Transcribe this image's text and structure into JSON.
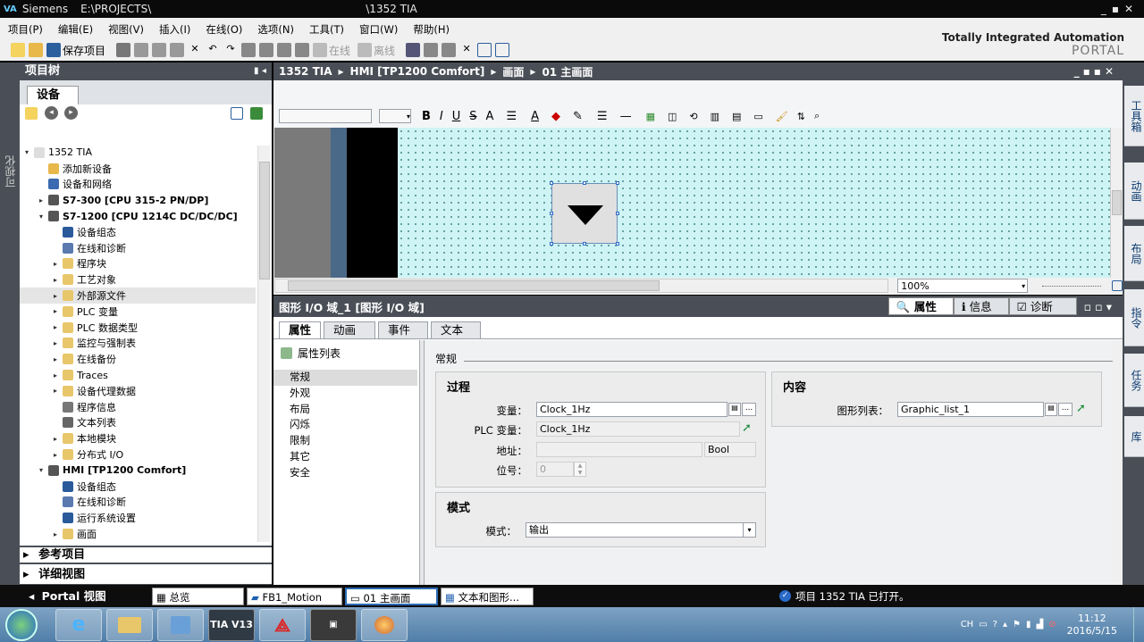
{
  "window": {
    "app": "Siemens",
    "path": "E:\\PROJECTS\\",
    "path_end": "\\1352 TIA"
  },
  "menu": [
    "项目(P)",
    "编辑(E)",
    "视图(V)",
    "插入(I)",
    "在线(O)",
    "选项(N)",
    "工具(T)",
    "窗口(W)",
    "帮助(H)"
  ],
  "toolbar": {
    "save_label": "保存项目",
    "online_label": "在线",
    "offline_label": "离线"
  },
  "brand": {
    "line1": "Totally Integrated Automation",
    "line2": "PORTAL"
  },
  "left_vtab": "可视化",
  "project_tree": {
    "title": "项目树",
    "tab": "设备",
    "items": [
      {
        "label": "1352 TIA",
        "indent": 0,
        "arrow": "▾",
        "icon": "project-icon",
        "bold": false
      },
      {
        "label": "添加新设备",
        "indent": 1,
        "arrow": "",
        "icon": "add-device-icon",
        "bold": false
      },
      {
        "label": "设备和网络",
        "indent": 1,
        "arrow": "",
        "icon": "network-icon",
        "bold": false
      },
      {
        "label": "S7-300 [CPU 315-2 PN/DP]",
        "indent": 1,
        "arrow": "▸",
        "icon": "plc-icon",
        "bold": true
      },
      {
        "label": "S7-1200 [CPU 1214C DC/DC/DC]",
        "indent": 1,
        "arrow": "▾",
        "icon": "plc-icon",
        "bold": true
      },
      {
        "label": "设备组态",
        "indent": 2,
        "arrow": "",
        "icon": "device-config-icon",
        "bold": false
      },
      {
        "label": "在线和诊断",
        "indent": 2,
        "arrow": "",
        "icon": "diagnostics-icon",
        "bold": false
      },
      {
        "label": "程序块",
        "indent": 2,
        "arrow": "▸",
        "icon": "folder-icon",
        "bold": false
      },
      {
        "label": "工艺对象",
        "indent": 2,
        "arrow": "▸",
        "icon": "folder-icon",
        "bold": false
      },
      {
        "label": "外部源文件",
        "indent": 2,
        "arrow": "▸",
        "icon": "folder-icon",
        "bold": false,
        "selected": true
      },
      {
        "label": "PLC 变量",
        "indent": 2,
        "arrow": "▸",
        "icon": "folder-icon",
        "bold": false
      },
      {
        "label": "PLC 数据类型",
        "indent": 2,
        "arrow": "▸",
        "icon": "folder-icon",
        "bold": false
      },
      {
        "label": "监控与强制表",
        "indent": 2,
        "arrow": "▸",
        "icon": "folder-icon",
        "bold": false
      },
      {
        "label": "在线备份",
        "indent": 2,
        "arrow": "▸",
        "icon": "folder-icon",
        "bold": false
      },
      {
        "label": "Traces",
        "indent": 2,
        "arrow": "▸",
        "icon": "folder-icon",
        "bold": false
      },
      {
        "label": "设备代理数据",
        "indent": 2,
        "arrow": "▸",
        "icon": "folder-icon",
        "bold": false
      },
      {
        "label": "程序信息",
        "indent": 2,
        "arrow": "",
        "icon": "program-info-icon",
        "bold": false
      },
      {
        "label": "文本列表",
        "indent": 2,
        "arrow": "",
        "icon": "text-list-icon",
        "bold": false
      },
      {
        "label": "本地模块",
        "indent": 2,
        "arrow": "▸",
        "icon": "folder-icon",
        "bold": false
      },
      {
        "label": "分布式 I/O",
        "indent": 2,
        "arrow": "▸",
        "icon": "folder-icon",
        "bold": false
      },
      {
        "label": "HMI [TP1200 Comfort]",
        "indent": 1,
        "arrow": "▾",
        "icon": "hmi-icon",
        "bold": true
      },
      {
        "label": "设备组态",
        "indent": 2,
        "arrow": "",
        "icon": "device-config-icon",
        "bold": false
      },
      {
        "label": "在线和诊断",
        "indent": 2,
        "arrow": "",
        "icon": "diagnostics-icon",
        "bold": false
      },
      {
        "label": "运行系统设置",
        "indent": 2,
        "arrow": "",
        "icon": "runtime-icon",
        "bold": false
      },
      {
        "label": "画面",
        "indent": 2,
        "arrow": "▸",
        "icon": "folder-icon",
        "bold": false
      }
    ],
    "ref_projects": "参考项目",
    "detail_view": "详细视图"
  },
  "editor": {
    "breadcrumb": [
      "1352 TIA",
      "HMI [TP1200 Comfort]",
      "画面",
      "01 主画面"
    ],
    "zoom": "100%"
  },
  "inspector": {
    "title": "图形 I/O 域_1 [图形 I/O 域]",
    "right_tabs": [
      "属性",
      "信息",
      "诊断"
    ],
    "tabs": [
      "属性",
      "动画",
      "事件",
      "文本"
    ],
    "list_header": "属性列表",
    "list": [
      "常规",
      "外观",
      "布局",
      "闪烁",
      "限制",
      "其它",
      "安全"
    ],
    "section": "常规",
    "process": {
      "title": "过程",
      "var_label": "变量：",
      "var_value": "Clock_1Hz",
      "plc_label": "PLC 变量：",
      "plc_value": "Clock_1Hz",
      "addr_label": "地址：",
      "addr_type": "Bool",
      "bit_label": "位号：",
      "bit_value": "0"
    },
    "mode": {
      "title": "模式",
      "label": "模式：",
      "value": "输出"
    },
    "content": {
      "title": "内容",
      "label": "图形列表：",
      "value": "Graphic_list_1"
    }
  },
  "right_tabs": [
    "工具箱",
    "动画",
    "布局",
    "指令",
    "任务",
    "库"
  ],
  "statusbar": {
    "portal": "Portal 视图",
    "tabs": [
      "总览",
      "FB1_Motion",
      "01 主画面",
      "文本和图形..."
    ],
    "status": "项目 1352 TIA 已打开。"
  },
  "taskbar": {
    "time": "11:12",
    "date": "2016/5/15",
    "lang": "CH",
    "apps": [
      "tia-v13",
      "pdf",
      "vmware"
    ],
    "tia_text": "TIA V13"
  }
}
